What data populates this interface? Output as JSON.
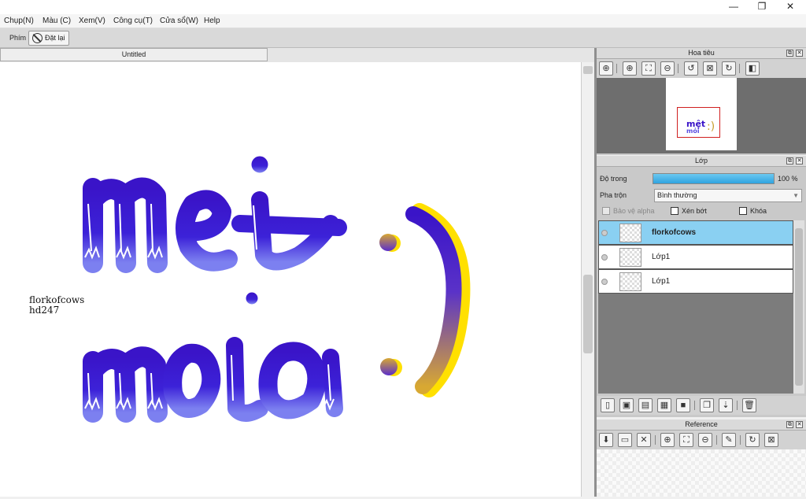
{
  "window": {
    "minimize_glyph": "—",
    "restore_glyph": "❐",
    "close_glyph": "✕"
  },
  "menu": [
    "Chụp(N)",
    "Màu (C)",
    "Xem(V)",
    "Công cụ(T)",
    "Cửa sổ(W)",
    "Help"
  ],
  "toolbar": {
    "label": "Phím",
    "reset_button": "Đặt lại",
    "reset_icon": "no-entry-icon"
  },
  "document": {
    "tab_title": "Untitled"
  },
  "artwork": {
    "line1": "mệt",
    "line2": "mỏi",
    "smile": ":)",
    "caption_line1": "florkofcows",
    "caption_line2": "hd247",
    "colors": {
      "letter_top": "#3a14c8",
      "letter_bottom": "#7a7cf0",
      "outline": "#ffffff",
      "accent": "#ffe000",
      "paren_top": "#3a14c8",
      "paren_bottom": "#d8a832"
    }
  },
  "navigator": {
    "title": "Hoa tiêu",
    "icons": [
      "zoom-fit-icon",
      "zoom-in-icon",
      "fit-screen-icon",
      "zoom-out-icon",
      "rotate-left-icon",
      "actual-size-icon",
      "rotate-right-icon",
      "flip-icon"
    ],
    "preview_text": "mệt mỏi :)"
  },
  "layers": {
    "title": "Lớp",
    "opacity_label": "Độ trong",
    "opacity_value": "100 %",
    "opacity_fraction": 1.0,
    "blend_label": "Pha trộn",
    "blend_value": "Bình thường",
    "protect_alpha_label": "Bảo vệ alpha",
    "clipping_label": "Xén bớt",
    "lock_label": "Khóa",
    "items": [
      {
        "name": "florkofcows",
        "active": true
      },
      {
        "name": "Lớp1",
        "active": false
      },
      {
        "name": "Lớp1",
        "active": false
      }
    ],
    "bottom_icons": [
      "new-layer-icon",
      "new-raster-icon",
      "new-vector-icon",
      "new-fill-icon",
      "new-folder-icon",
      "duplicate-layer-icon",
      "merge-down-icon",
      "delete-layer-icon"
    ]
  },
  "reference": {
    "title": "Reference",
    "icons": [
      "import-image-icon",
      "open-folder-icon",
      "close-icon",
      "zoom-in-icon",
      "fit-screen-icon",
      "zoom-out-icon",
      "eyedropper-icon",
      "rotate-icon",
      "actual-size-icon"
    ]
  }
}
